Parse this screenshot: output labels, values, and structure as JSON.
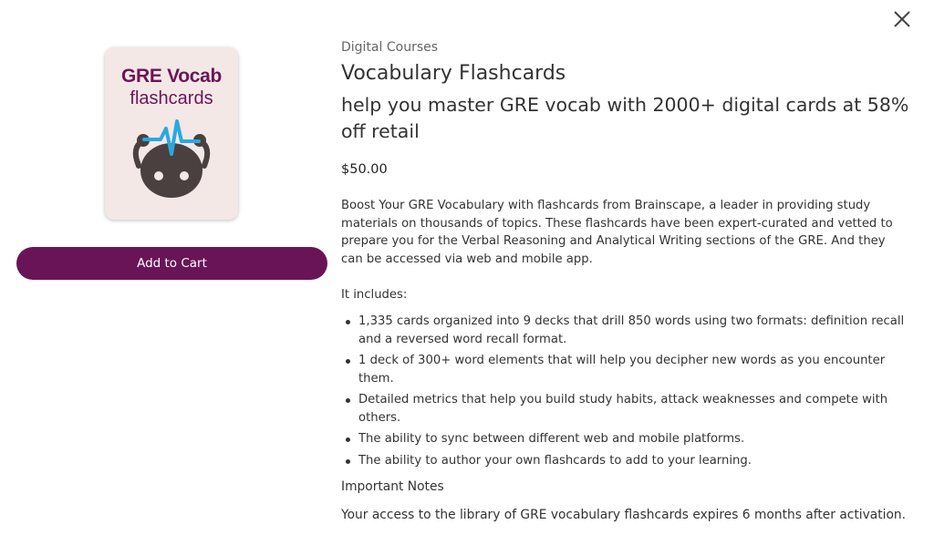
{
  "product": {
    "image": {
      "title": "GRE Vocab",
      "subtitle": "flashcards",
      "icon": "brainscape-logo-icon"
    },
    "add_to_cart_label": "Add to Cart",
    "category": "Digital Courses",
    "title": "Vocabulary Flashcards",
    "subtitle": "help you master GRE vocab with 2000+ digital cards at 58% off retail",
    "price": "$50.00",
    "description": "Boost Your GRE Vocabulary with flashcards from Brainscape, a leader in providing study materials on thousands of topics. These flashcards have been expert-curated and vetted to prepare you for the Verbal Reasoning and Analytical Writing sections of the GRE. And they can be accessed via web and mobile app.",
    "includes_label": "It includes:",
    "includes": [
      "1,335 cards organized into 9 decks that drill 850 words using two formats: definition recall and a reversed word recall format.",
      "1 deck of 300+ word elements that will help you decipher new words as you encounter them.",
      "Detailed metrics that help you build study habits, attack weaknesses and compete with others.",
      "The ability to sync between different web and mobile platforms.",
      "The ability to author your own flashcards to add to your learning."
    ],
    "notes_label": "Important Notes",
    "notes_text": "Your access to the library of GRE vocabulary flashcards expires 6 months after activation."
  },
  "icons": {
    "close": "close-icon"
  },
  "colors": {
    "brand": "#6a1458",
    "image_background": "#f4e8e6",
    "logo_dark": "#4a4040",
    "logo_accent": "#2aa9e0"
  }
}
